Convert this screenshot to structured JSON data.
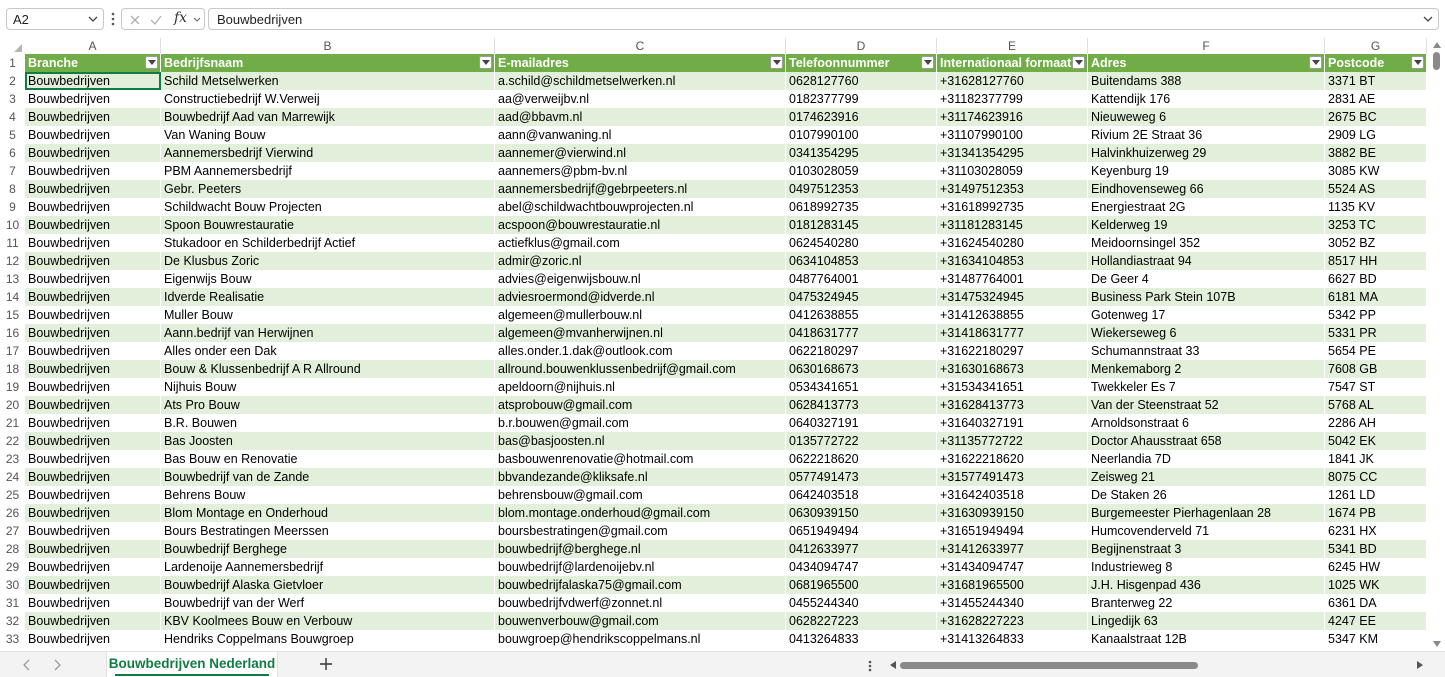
{
  "formula_bar": {
    "name_box": "A2",
    "fx_label": "fx",
    "formula": "Bouwbedrijven"
  },
  "column_letters": [
    "A",
    "B",
    "C",
    "D",
    "E",
    "F",
    "G"
  ],
  "header_row_number": "1",
  "headers": [
    "Branche",
    "Bedrijfsnaam",
    "E-mailadres",
    "Telefoonnummer",
    "Internationaal formaat",
    "Adres",
    "Postcode"
  ],
  "rows": [
    {
      "n": "2",
      "c": [
        "Bouwbedrijven",
        "Schild Metselwerken",
        "a.schild@schildmetselwerken.nl",
        "0628127760",
        "+31628127760",
        "Buitendams 388",
        "3371 BT"
      ]
    },
    {
      "n": "3",
      "c": [
        "Bouwbedrijven",
        "Constructiebedrijf W.Verweij",
        "aa@verweijbv.nl",
        "0182377799",
        "+31182377799",
        "Kattendijk 176",
        "2831 AE"
      ]
    },
    {
      "n": "4",
      "c": [
        "Bouwbedrijven",
        "Bouwbedrijf Aad van Marrewijk",
        "aad@bbavm.nl",
        "0174623916",
        "+31174623916",
        "Nieuweweg 6",
        "2675 BC"
      ]
    },
    {
      "n": "5",
      "c": [
        "Bouwbedrijven",
        "Van Waning Bouw",
        "aann@vanwaning.nl",
        "0107990100",
        "+31107990100",
        "Rivium 2E Straat 36",
        "2909 LG"
      ]
    },
    {
      "n": "6",
      "c": [
        "Bouwbedrijven",
        "Aannemersbedrijf Vierwind",
        "aannemer@vierwind.nl",
        "0341354295",
        "+31341354295",
        "Halvinkhuizerweg 29",
        "3882 BE"
      ]
    },
    {
      "n": "7",
      "c": [
        "Bouwbedrijven",
        "PBM Aannemersbedrijf",
        "aannemers@pbm-bv.nl",
        "0103028059",
        "+31103028059",
        "Keyenburg 19",
        "3085 KW"
      ]
    },
    {
      "n": "8",
      "c": [
        "Bouwbedrijven",
        "Gebr. Peeters",
        "aannemersbedrijf@gebrpeeters.nl",
        "0497512353",
        "+31497512353",
        "Eindhovenseweg 66",
        "5524 AS"
      ]
    },
    {
      "n": "9",
      "c": [
        "Bouwbedrijven",
        "Schildwacht Bouw Projecten",
        "abel@schildwachtbouwprojecten.nl",
        "0618992735",
        "+31618992735",
        "Energiestraat 2G",
        "1135 KV"
      ]
    },
    {
      "n": "10",
      "c": [
        "Bouwbedrijven",
        "Spoon Bouwrestauratie",
        "acspoon@bouwrestauratie.nl",
        "0181283145",
        "+31181283145",
        "Kelderweg 19",
        "3253 TC"
      ]
    },
    {
      "n": "11",
      "c": [
        "Bouwbedrijven",
        "Stukadoor en Schilderbedrijf Actief",
        "actiefklus@gmail.com",
        "0624540280",
        "+31624540280",
        "Meidoornsingel 352",
        "3052 BZ"
      ]
    },
    {
      "n": "12",
      "c": [
        "Bouwbedrijven",
        "De Klusbus Zoric",
        "admir@zoric.nl",
        "0634104853",
        "+31634104853",
        "Hollandiastraat 94",
        "8517 HH"
      ]
    },
    {
      "n": "13",
      "c": [
        "Bouwbedrijven",
        "Eigenwijs Bouw",
        "advies@eigenwijsbouw.nl",
        "0487764001",
        "+31487764001",
        "De Geer 4",
        "6627 BD"
      ]
    },
    {
      "n": "14",
      "c": [
        "Bouwbedrijven",
        "Idverde Realisatie",
        "adviesroermond@idverde.nl",
        "0475324945",
        "+31475324945",
        "Business Park Stein 107B",
        "6181 MA"
      ]
    },
    {
      "n": "15",
      "c": [
        "Bouwbedrijven",
        "Muller Bouw",
        "algemeen@mullerbouw.nl",
        "0412638855",
        "+31412638855",
        "Gotenweg 17",
        "5342 PP"
      ]
    },
    {
      "n": "16",
      "c": [
        "Bouwbedrijven",
        "Aann.bedrijf van Herwijnen",
        "algemeen@mvanherwijnen.nl",
        "0418631777",
        "+31418631777",
        "Wiekerseweg 6",
        "5331 PR"
      ]
    },
    {
      "n": "17",
      "c": [
        "Bouwbedrijven",
        "Alles onder een Dak",
        "alles.onder.1.dak@outlook.com",
        "0622180297",
        "+31622180297",
        "Schumannstraat 33",
        "5654 PE"
      ]
    },
    {
      "n": "18",
      "c": [
        "Bouwbedrijven",
        "Bouw & Klussenbedrijf A R Allround",
        "allround.bouwenklussenbedrijf@gmail.com",
        "0630168673",
        "+31630168673",
        "Menkemaborg 2",
        "7608 GB"
      ]
    },
    {
      "n": "19",
      "c": [
        "Bouwbedrijven",
        "Nijhuis Bouw",
        "apeldoorn@nijhuis.nl",
        "0534341651",
        "+31534341651",
        "Twekkeler Es 7",
        "7547 ST"
      ]
    },
    {
      "n": "20",
      "c": [
        "Bouwbedrijven",
        "Ats Pro Bouw",
        "atsprobouw@gmail.com",
        "0628413773",
        "+31628413773",
        "Van der Steenstraat 52",
        "5768 AL"
      ]
    },
    {
      "n": "21",
      "c": [
        "Bouwbedrijven",
        "B.R. Bouwen",
        "b.r.bouwen@gmail.com",
        "0640327191",
        "+31640327191",
        "Arnoldsonstraat 6",
        "2286 AH"
      ]
    },
    {
      "n": "22",
      "c": [
        "Bouwbedrijven",
        "Bas Joosten",
        "bas@basjoosten.nl",
        "0135772722",
        "+31135772722",
        "Doctor Ahausstraat 658",
        "5042 EK"
      ]
    },
    {
      "n": "23",
      "c": [
        "Bouwbedrijven",
        "Bas Bouw en Renovatie",
        "basbouwenrenovatie@hotmail.com",
        "0622218620",
        "+31622218620",
        "Neerlandia 7D",
        "1841 JK"
      ]
    },
    {
      "n": "24",
      "c": [
        "Bouwbedrijven",
        "Bouwbedrijf van de Zande",
        "bbvandezande@kliksafe.nl",
        "0577491473",
        "+31577491473",
        "Zeisweg 21",
        "8075 CC"
      ]
    },
    {
      "n": "25",
      "c": [
        "Bouwbedrijven",
        "Behrens Bouw",
        "behrensbouw@gmail.com",
        "0642403518",
        "+31642403518",
        "De Staken 26",
        "1261 LD"
      ]
    },
    {
      "n": "26",
      "c": [
        "Bouwbedrijven",
        "Blom Montage en Onderhoud",
        "blom.montage.onderhoud@gmail.com",
        "0630939150",
        "+31630939150",
        "Burgemeester Pierhagenlaan 28",
        "1674 PB"
      ]
    },
    {
      "n": "27",
      "c": [
        "Bouwbedrijven",
        "Bours Bestratingen Meerssen",
        "boursbestratingen@gmail.com",
        "0651949494",
        "+31651949494",
        "Humcovenderveld 71",
        "6231 HX"
      ]
    },
    {
      "n": "28",
      "c": [
        "Bouwbedrijven",
        "Bouwbedrijf Berghege",
        "bouwbedrijf@berghege.nl",
        "0412633977",
        "+31412633977",
        "Begijnenstraat 3",
        "5341 BD"
      ]
    },
    {
      "n": "29",
      "c": [
        "Bouwbedrijven",
        "Lardenoije Aannemersbedrijf",
        "bouwbedrijf@lardenoijebv.nl",
        "0434094747",
        "+31434094747",
        "Industrieweg 8",
        "6245 HW"
      ]
    },
    {
      "n": "30",
      "c": [
        "Bouwbedrijven",
        "Bouwbedrijf Alaska Gietvloer",
        "bouwbedrijfalaska75@gmail.com",
        "0681965500",
        "+31681965500",
        "J.H. Hisgenpad 436",
        "1025 WK"
      ]
    },
    {
      "n": "31",
      "c": [
        "Bouwbedrijven",
        "Bouwbedrijf van der Werf",
        "bouwbedrijfvdwerf@zonnet.nl",
        "0455244340",
        "+31455244340",
        "Branterweg 22",
        "6361 DA"
      ]
    },
    {
      "n": "32",
      "c": [
        "Bouwbedrijven",
        "KBV Koolmees Bouw en Verbouw",
        "bouwenverbouw@gmail.com",
        "0628227223",
        "+31628227223",
        "Lingedijk 63",
        "4247 EE"
      ]
    },
    {
      "n": "33",
      "c": [
        "Bouwbedrijven",
        "Hendriks Coppelmans Bouwgroep",
        "bouwgroep@hendrikscoppelmans.nl",
        "0413264833",
        "+31413264833",
        "Kanaalstraat 12B",
        "5347 KM"
      ]
    }
  ],
  "sheet_tab": "Bouwbedrijven Nederland",
  "colors": {
    "header_fill": "#70ad47",
    "band_fill": "#e2efda",
    "accent": "#107c41"
  }
}
